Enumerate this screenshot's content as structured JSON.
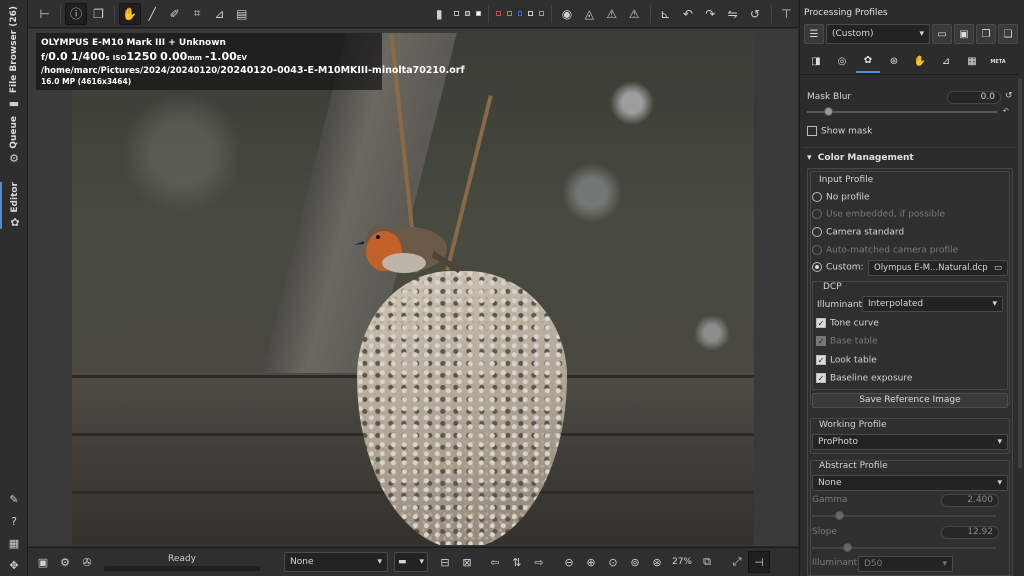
{
  "left_tabs": {
    "file_browser": "File Browser (26)",
    "queue": "Queue",
    "editor": "Editor"
  },
  "info_overlay": {
    "camera": "OLYMPUS E-M10 Mark III + Unknown",
    "aperture_prefix": "f/",
    "aperture": "0.0",
    "shutter": "1/400",
    "shutter_unit": "s",
    "iso_label": "ISO",
    "iso": "1250",
    "focal": "0.00",
    "focal_unit": "mm",
    "ev": "-1.00",
    "ev_unit": "EV",
    "path": "/home/marc/Pictures/2024/20240120/",
    "filename": "20240120-0043-E-M10MKIII-minolta70210.orf",
    "size": "16.0 MP (4616x3464)"
  },
  "status": {
    "text": "Ready"
  },
  "bottom": {
    "profile_select": "None",
    "zoom": "27%"
  },
  "right_panel": {
    "title": "Processing Profiles",
    "profile_select": "(Custom)",
    "mask_blur_label": "Mask Blur",
    "mask_blur_value": "0.0",
    "show_mask": "Show mask",
    "color_management": "Color Management",
    "input_profile": {
      "title": "Input Profile",
      "options": [
        "No profile",
        "Use embedded, if possible",
        "Camera standard",
        "Auto-matched camera profile",
        "Custom:"
      ],
      "custom_file": "Olympus E-M...Natural.dcp"
    },
    "dcp": {
      "title": "DCP",
      "illuminant_label": "Illuminant:",
      "illuminant_value": "Interpolated",
      "checks": [
        "Tone curve",
        "Base table",
        "Look table",
        "Baseline exposure"
      ]
    },
    "save_ref": "Save Reference Image",
    "working_profile": {
      "title": "Working Profile",
      "value": "ProPhoto"
    },
    "abstract_profile": {
      "title": "Abstract Profile",
      "value": "None",
      "gamma_label": "Gamma",
      "gamma_value": "2.400",
      "slope_label": "Slope",
      "slope_value": "12.92",
      "illuminant_label": "Illuminant:",
      "illuminant_value": "D50"
    }
  }
}
